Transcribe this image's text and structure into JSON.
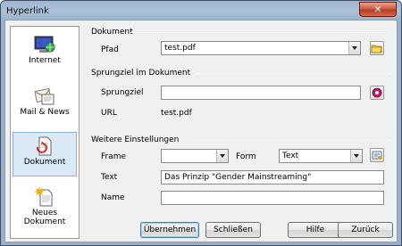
{
  "window": {
    "title": "Hyperlink",
    "close_glyph": "✕"
  },
  "nav": [
    {
      "label": "Internet",
      "icon": "internet-globe-icon"
    },
    {
      "label": "Mail & News",
      "icon": "mail-news-icon"
    },
    {
      "label": "Dokument",
      "icon": "document-link-icon",
      "selected": true
    },
    {
      "label": "Neues Dokument",
      "icon": "new-document-icon"
    }
  ],
  "dokument": {
    "section_title": "Dokument",
    "path_label": "Pfad",
    "path_value": "test.pdf"
  },
  "sprungziel": {
    "section_title": "Sprungziel im Dokument",
    "target_label": "Sprungziel",
    "target_value": "",
    "url_label": "URL",
    "url_value": "test.pdf"
  },
  "weitere": {
    "section_title": "Weitere Einstellungen",
    "frame_label": "Frame",
    "frame_value": "",
    "form_label": "Form",
    "form_value": "Text",
    "text_label": "Text",
    "text_value": "Das Prinzip \"Gender Mainstreaming\"",
    "name_label": "Name",
    "name_value": ""
  },
  "buttons": {
    "apply": "Übernehmen",
    "close": "Schließen",
    "help": "Hilfe",
    "back": "Zurück"
  }
}
